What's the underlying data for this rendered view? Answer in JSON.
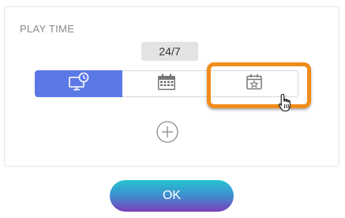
{
  "panel": {
    "title": "PLAY TIME",
    "schedule_badge": "24/7"
  },
  "mode_selector": {
    "options": [
      {
        "icon": "monitor-clock-icon",
        "selected": true
      },
      {
        "icon": "calendar-icon",
        "selected": false
      },
      {
        "icon": "calendar-star-icon",
        "selected": false
      }
    ]
  },
  "actions": {
    "add_icon": "plus-circle-icon",
    "ok_label": "OK"
  },
  "colors": {
    "selected_segment": "#5b79e6",
    "highlight_outline": "#f08c1a",
    "ok_gradient_top": "#24c4cf",
    "ok_gradient_bottom": "#7c3fb8"
  }
}
